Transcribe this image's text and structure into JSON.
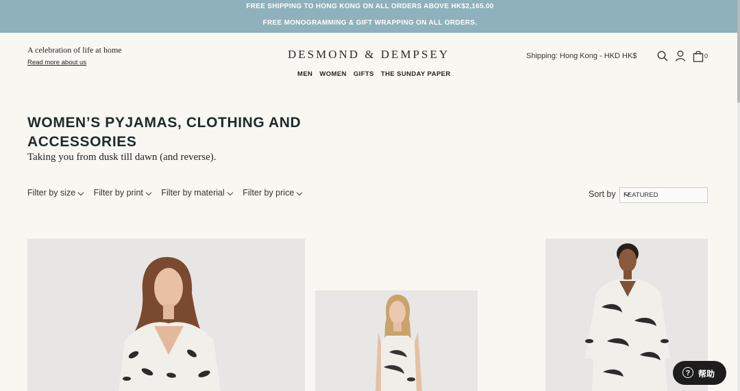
{
  "banner": {
    "line1": "FREE SHIPPING TO HONG KONG ON ALL ORDERS ABOVE HK$2,165.00",
    "line2": "FREE MONOGRAMMING & GIFT WRAPPING ON ALL ORDERS."
  },
  "header": {
    "tagline": "A celebration of life at home",
    "read_more": "Read more about us",
    "logo": "DESMOND & DEMPSEY",
    "nav": [
      "MEN",
      "WOMEN",
      "GIFTS",
      "THE SUNDAY PAPER"
    ],
    "shipping": "Shipping: Hong Kong - HKD HK$",
    "cart_count": "0",
    "icons": [
      "search-icon",
      "account-icon",
      "bag-icon"
    ]
  },
  "collection": {
    "title": "WOMEN’S PYJAMAS, CLOTHING AND ACCESSORIES",
    "subtitle": "Taking you from dusk till dawn (and reverse)."
  },
  "filters": [
    "Filter by size",
    "Filter by print",
    "Filter by material",
    "Filter by price"
  ],
  "sort": {
    "label": "Sort by",
    "selected": "FEATURED"
  },
  "help": {
    "label": "帮助"
  },
  "colors": {
    "banner": "#8eb1bb",
    "background": "#f8f7f2",
    "title": "#1e2a2a",
    "help_button": "#1d1d1d"
  }
}
